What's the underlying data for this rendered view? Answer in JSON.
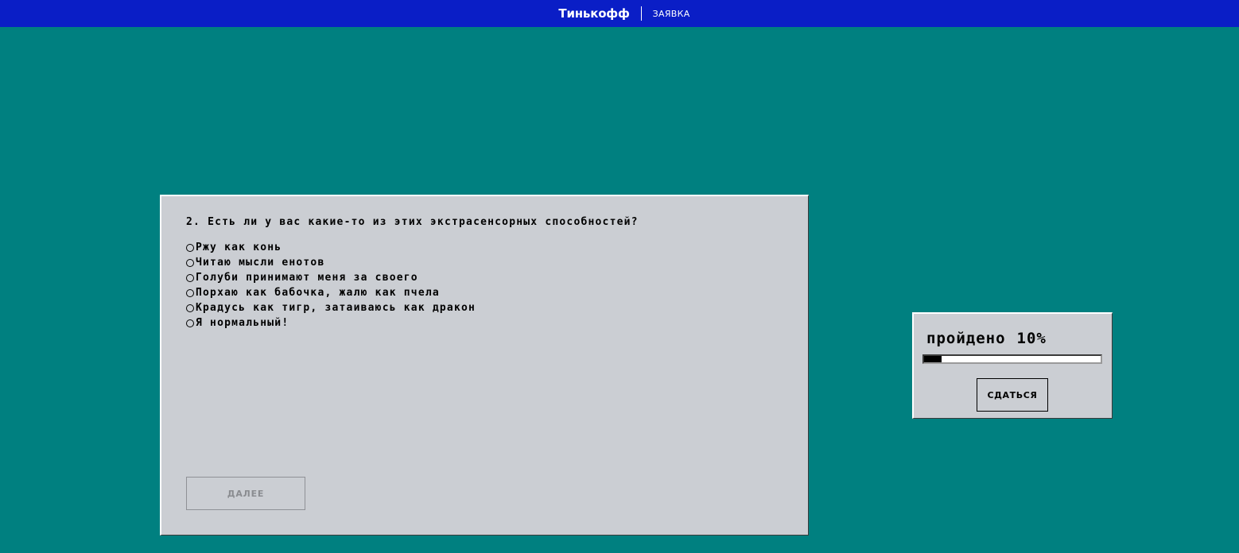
{
  "header": {
    "brand": "Тинькофф",
    "section": "ЗАЯВКА"
  },
  "question": {
    "title": "2. Есть ли у вас какие-то из этих экстрасенсорных способностей?",
    "options": [
      {
        "label": "Ржу как конь",
        "selected": false
      },
      {
        "label": "Читаю мысли енотов",
        "selected": false
      },
      {
        "label": "Голуби принимают меня за своего",
        "selected": false
      },
      {
        "label": "Порхаю как бабочка, жалю как пчела",
        "selected": false
      },
      {
        "label": "Крадусь как тигр, затаиваюсь как дракон",
        "selected": false
      },
      {
        "label": "Я нормальный!",
        "selected": false
      }
    ],
    "next_label": "ДАЛЕЕ"
  },
  "progress": {
    "label": "пройдено",
    "percent_text": "10%",
    "percent": 10,
    "surrender_label": "СДАТЬСЯ"
  },
  "colors": {
    "desktop": "#008080",
    "topbar": "#0a1ec6",
    "window": "#cbced3"
  }
}
